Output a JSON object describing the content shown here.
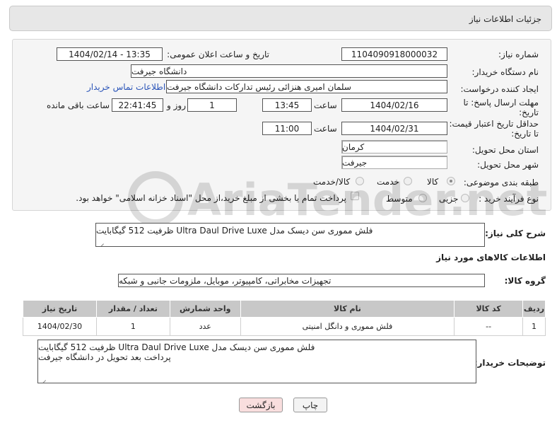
{
  "header": {
    "title": "جزئیات اطلاعات نیاز"
  },
  "form": {
    "need_number_label": "شماره نیاز:",
    "need_number": "1104090918000032",
    "announce_label": "تاریخ و ساعت اعلان عمومی:",
    "announce_value": "1404/02/14 - 13:35",
    "buyer_org_label": "نام دستگاه خریدار:",
    "buyer_org": "دانشگاه جیرفت",
    "requester_label": "ایجاد کننده درخواست:",
    "requester": "سلمان امیری هنزائی رئیس تدارکات دانشگاه جیرفت",
    "contact_link": "اطلاعات تماس خریدار",
    "deadline_label_1": "مهلت ارسال پاسخ: تا",
    "deadline_label_2": "تاریخ:",
    "deadline_date": "1404/02/16",
    "time_label": "ساعت",
    "deadline_time": "13:45",
    "days_value": "1",
    "days_label": "روز و",
    "remaining_time": "22:41:45",
    "remaining_label": "ساعت باقی مانده",
    "validity_label_1": "حداقل تاریخ اعتبار قیمت:",
    "validity_label_2": "تا تاریخ:",
    "validity_date": "1404/02/31",
    "validity_time": "11:00",
    "province_label": "استان محل تحویل:",
    "province": "کرمان",
    "city_label": "شهر محل تحویل:",
    "city": "جیرفت",
    "category_label": "طبقه بندی موضوعی:",
    "category_options": [
      "کالا",
      "خدمت",
      "کالا/خدمت"
    ],
    "process_label": "نوع فرآیند خرید :",
    "process_options": [
      "جزیی",
      "متوسط"
    ],
    "payment_text": "پرداخت تمام یا بخشی از مبلغ خرید،از محل \"اسناد خزانه اسلامی\" خواهد بود."
  },
  "general_desc": {
    "label": "شرح کلی نیاز:",
    "value": "فلش مموری سن دیسک مدل Ultra Daul Drive Luxe ظرفیت 512 گیگابایت"
  },
  "goods_section": {
    "title": "اطلاعات کالاهای مورد نیاز",
    "group_label": "گروه کالا:",
    "group_value": "تجهیزات مخابراتی، کامپیوتر، موبایل، ملزومات جانبی و شبکه",
    "columns": [
      "ردیف",
      "کد کالا",
      "نام کالا",
      "واحد شمارش",
      "تعداد / مقدار",
      "تاریخ نیاز"
    ],
    "rows": [
      {
        "row": "1",
        "code": "--",
        "name": "فلش مموری و دانگل امنیتی",
        "unit": "عدد",
        "qty": "1",
        "date": "1404/02/30"
      }
    ]
  },
  "buyer_desc": {
    "label": "توضیحات خریدار:",
    "line1": "فلش مموری سن دیسک مدل Ultra Daul Drive Luxe ظرفیت 512 گیگابایت",
    "line2": "پرداخت بعد تحویل در دانشگاه جیرفت"
  },
  "buttons": {
    "print": "چاپ",
    "back": "بازگشت"
  },
  "watermark": "AriaTender.net",
  "colors": {
    "link": "#2a54b8",
    "back_button": "#f9dede",
    "header_bg": "#e7e7e7",
    "table_header": "#c8c8c8"
  }
}
